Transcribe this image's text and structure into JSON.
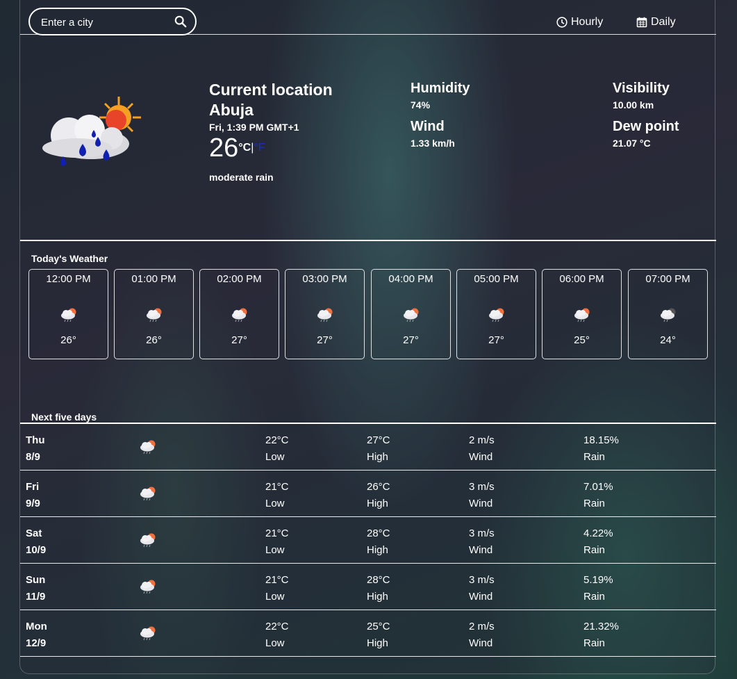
{
  "search": {
    "placeholder": "Enter a city",
    "icon": "search-icon"
  },
  "nav": {
    "hourly": "Hourly",
    "daily": "Daily"
  },
  "current": {
    "title": "Current location",
    "city": "Abuja",
    "time": "Fri, 1:39 PM GMT+1",
    "temp": "26",
    "unit_c": "°C",
    "sep": "|",
    "unit_f": "°F",
    "condition": "moderate rain",
    "humidity_label": "Humidity",
    "humidity": "74%",
    "wind_label": "Wind",
    "wind": "1.33 km/h",
    "visibility_label": "Visibility",
    "visibility": "10.00 km",
    "dew_label": "Dew point",
    "dew": "21.07 °C"
  },
  "today": {
    "title": "Today's Weather",
    "hours": [
      {
        "time": "12:00 PM",
        "temp": "26°",
        "icon": "sun-cloud-rain-icon"
      },
      {
        "time": "01:00 PM",
        "temp": "26°",
        "icon": "sun-cloud-rain-icon"
      },
      {
        "time": "02:00 PM",
        "temp": "27°",
        "icon": "sun-cloud-rain-icon"
      },
      {
        "time": "03:00 PM",
        "temp": "27°",
        "icon": "sun-cloud-rain-icon"
      },
      {
        "time": "04:00 PM",
        "temp": "27°",
        "icon": "sun-cloud-rain-icon"
      },
      {
        "time": "05:00 PM",
        "temp": "27°",
        "icon": "sun-cloud-rain-icon"
      },
      {
        "time": "06:00 PM",
        "temp": "25°",
        "icon": "sun-cloud-rain-icon"
      },
      {
        "time": "07:00 PM",
        "temp": "24°",
        "icon": "moon-cloud-rain-icon"
      }
    ]
  },
  "five": {
    "title": "Next five days",
    "low_label": "Low",
    "high_label": "High",
    "wind_label": "Wind",
    "rain_label": "Rain",
    "days": [
      {
        "day": "Thu",
        "date": "8/9",
        "low": "22°C",
        "high": "27°C",
        "wind": "2 m/s",
        "rain": "18.15%"
      },
      {
        "day": "Fri",
        "date": "9/9",
        "low": "21°C",
        "high": "26°C",
        "wind": "3 m/s",
        "rain": "7.01%"
      },
      {
        "day": "Sat",
        "date": "10/9",
        "low": "21°C",
        "high": "28°C",
        "wind": "3 m/s",
        "rain": "4.22%"
      },
      {
        "day": "Sun",
        "date": "11/9",
        "low": "21°C",
        "high": "28°C",
        "wind": "3 m/s",
        "rain": "5.19%"
      },
      {
        "day": "Mon",
        "date": "12/9",
        "low": "22°C",
        "high": "25°C",
        "wind": "2 m/s",
        "rain": "21.32%"
      }
    ]
  }
}
